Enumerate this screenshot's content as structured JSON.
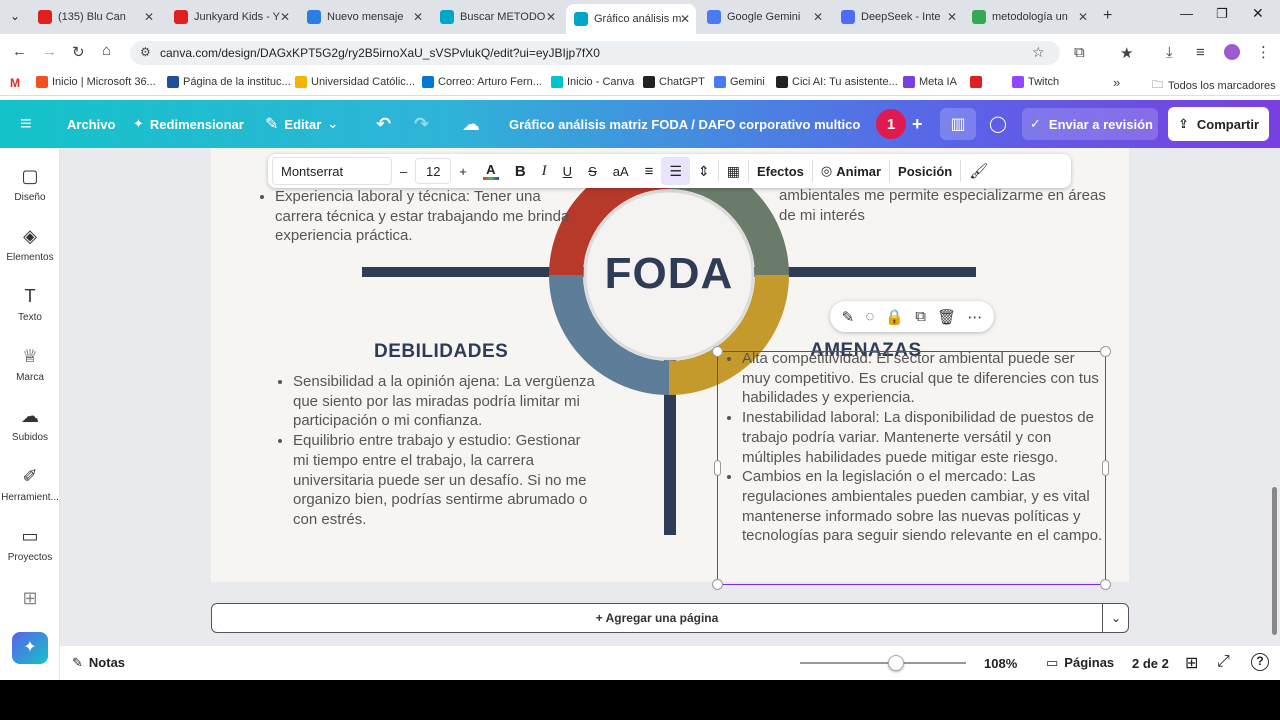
{
  "browser": {
    "tabs": [
      {
        "label": "(135) Blu Can",
        "color": "#e02020"
      },
      {
        "label": "Junkyard Kids - Y",
        "color": "#e02020"
      },
      {
        "label": "Nuevo mensaje",
        "color": "#2a7de1"
      },
      {
        "label": "Buscar METODO",
        "color": "#00a6c8"
      },
      {
        "label": "Gráfico análisis m",
        "color": "#00a6c8"
      },
      {
        "label": "Google Gemini",
        "color": "#4b7bf0"
      },
      {
        "label": "DeepSeek - Inte",
        "color": "#4d6bfe"
      },
      {
        "label": "metodología un",
        "color": "#34a853"
      }
    ],
    "new_tab": "+",
    "url": "canva.com/design/DAGxKPT5G2g/ry2B5irnoXaU_sVSPvlukQ/edit?ui=eyJBIjp7fX0",
    "bookmarks": [
      {
        "label": "Inicio | Microsoft 36...",
        "color": "#f25022"
      },
      {
        "label": "Página de la instituc...",
        "color": "#1f4e9a"
      },
      {
        "label": "Universidad Católic...",
        "color": "#f4b400"
      },
      {
        "label": "Correo: Arturo Fern...",
        "color": "#0078d4"
      },
      {
        "label": "Inicio - Canva",
        "color": "#00c4cc"
      },
      {
        "label": "ChatGPT",
        "color": "#222222"
      },
      {
        "label": "Gemini",
        "color": "#4b7bf0"
      },
      {
        "label": "Cici AI: Tu asistente...",
        "color": "#222222"
      },
      {
        "label": "Meta IA",
        "color": "#7a3fe0"
      },
      {
        "label": "",
        "color": "#e02020"
      },
      {
        "label": "Twitch",
        "color": "#9146ff"
      }
    ],
    "all_bookmarks": "Todos los marcadores"
  },
  "canva_header": {
    "file": "Archivo",
    "resize": "Redimensionar",
    "edit": "Editar",
    "doc_title": "Gráfico análisis matriz FODA / DAFO corporativo multicolor ...",
    "collab_count": "1",
    "review": "Enviar a revisión",
    "share": "Compartir"
  },
  "sidebar": [
    {
      "label": "Diseño",
      "icon": "layout-icon"
    },
    {
      "label": "Elementos",
      "icon": "shapes-icon"
    },
    {
      "label": "Texto",
      "icon": "text-icon"
    },
    {
      "label": "Marca",
      "icon": "brand-icon"
    },
    {
      "label": "Subidos",
      "icon": "upload-icon"
    },
    {
      "label": "Herramient...",
      "icon": "tools-icon"
    },
    {
      "label": "Proyectos",
      "icon": "folder-icon"
    }
  ],
  "toolbar": {
    "font": "Montserrat",
    "minus": "–",
    "size": "12",
    "plus": "+",
    "effects": "Efectos",
    "animate": "Animar",
    "position": "Posición"
  },
  "design": {
    "center_label": "FODA",
    "top_left_items": [
      "Experiencia laboral y técnica: Tener una carrera técnica y estar trabajando me brinda experiencia práctica."
    ],
    "top_right_tail": "ambientales me permite especializarme en áreas de mi interés",
    "weaknesses_title": "DEBILIDADES",
    "weaknesses": [
      "Sensibilidad a la opinión ajena: La vergüenza que siento por las miradas podría limitar mi participación o mi confianza.",
      "Equilibrio entre trabajo y estudio: Gestionar mi tiempo entre el trabajo, la carrera universitaria puede ser un desafío. Si no me organizo bien, podrías sentirme abrumado o con estrés."
    ],
    "threats_title": "AMENAZAS",
    "threats": [
      "Alta competitividad: El sector ambiental puede ser muy competitivo. Es crucial que te diferencies con tus habilidades y experiencia.",
      "Inestabilidad laboral: La disponibilidad de puestos de trabajo podría variar. Mantenerte versátil y con múltiples habilidades puede mitigar este riesgo.",
      "Cambios en la legislación o el mercado: Las regulaciones ambientales pueden cambiar, y es vital mantenerse informado sobre las nuevas políticas y tecnologías para seguir siendo relevante en el campo."
    ],
    "ring_colors": {
      "red": "#b7392a",
      "green": "#6b7b69",
      "blue": "#5e7d98",
      "gold": "#c49a2c",
      "dark": "#2f3c55"
    }
  },
  "footer": {
    "add_page": "+ Agregar una página",
    "notes": "Notas",
    "zoom": "108%",
    "zoom_level": 0.58,
    "pages": "Páginas",
    "page_count": "2 de 2"
  }
}
